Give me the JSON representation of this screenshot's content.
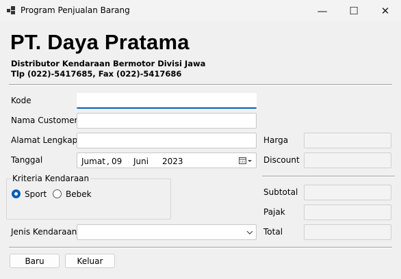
{
  "window": {
    "title": "Program Penjualan Barang",
    "minimize_glyph": "—",
    "maximize_glyph": "☐",
    "close_glyph": "✕",
    "icon": "app-icon"
  },
  "header": {
    "company": "PT. Daya Pratama",
    "line1": "Distributor Kendaraan Bermotor Divisi Jawa",
    "line2": "Tlp (022)-5417685, Fax (022)-5417686"
  },
  "form": {
    "kode_label": "Kode",
    "kode_value": "",
    "nama_label": "Nama Customer",
    "nama_value": "",
    "alamat_label": "Alamat Lengkap",
    "alamat_value": "",
    "tanggal_label": "Tanggal",
    "tanggal": {
      "day_name": "Jumat",
      "sep": ",",
      "day": "09",
      "month": "Juni",
      "year": "2023"
    },
    "kriteria_title": "Kriteria Kendaraan",
    "radio_sport": "Sport",
    "radio_bebek": "Bebek",
    "selected": "Sport",
    "jenis_label": "Jenis Kendaraan",
    "jenis_value": ""
  },
  "summary": {
    "harga_label": "Harga",
    "discount_label": "Discount",
    "subtotal_label": "Subtotal",
    "pajak_label": "Pajak",
    "total_label": "Total"
  },
  "buttons": {
    "baru": "Baru",
    "keluar": "Keluar"
  },
  "colors": {
    "accent": "#005fb8",
    "background": "#f0f0f0"
  }
}
